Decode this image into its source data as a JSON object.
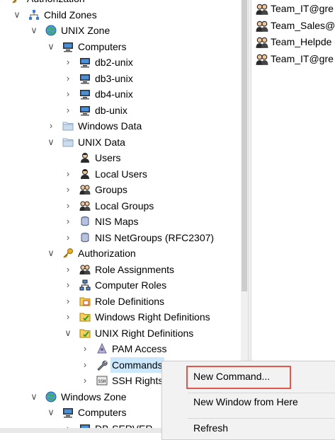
{
  "tree": [
    {
      "label": "Authorization",
      "icon": "key-icon",
      "chev": ">",
      "level": -1
    },
    {
      "label": "Child Zones",
      "icon": "org-chart-icon",
      "chev": "v",
      "level": 0
    },
    {
      "label": "UNIX Zone",
      "icon": "globe-icon",
      "chev": "v",
      "level": 1
    },
    {
      "label": "Computers",
      "icon": "computer-icon",
      "chev": "v",
      "level": 2
    },
    {
      "label": "db2-unix",
      "icon": "computer-icon",
      "chev": ">",
      "level": 3
    },
    {
      "label": "db3-unix",
      "icon": "computer-icon",
      "chev": ">",
      "level": 3
    },
    {
      "label": "db4-unix",
      "icon": "computer-icon",
      "chev": ">",
      "level": 3
    },
    {
      "label": "db-unix",
      "icon": "computer-icon",
      "chev": ">",
      "level": 3
    },
    {
      "label": "Windows Data",
      "icon": "folder-icon",
      "chev": ">",
      "level": 2
    },
    {
      "label": "UNIX Data",
      "icon": "folder-icon",
      "chev": "v",
      "level": 2
    },
    {
      "label": "Users",
      "icon": "user-icon",
      "chev": "",
      "level": 3
    },
    {
      "label": "Local Users",
      "icon": "user-icon",
      "chev": ">",
      "level": 3
    },
    {
      "label": "Groups",
      "icon": "group-icon",
      "chev": ">",
      "level": 3
    },
    {
      "label": "Local Groups",
      "icon": "group-icon",
      "chev": ">",
      "level": 3
    },
    {
      "label": "NIS Maps",
      "icon": "database-icon",
      "chev": ">",
      "level": 3
    },
    {
      "label": "NIS NetGroups (RFC2307)",
      "icon": "database-icon",
      "chev": ">",
      "level": 3
    },
    {
      "label": "Authorization",
      "icon": "key-icon",
      "chev": "v",
      "level": 2
    },
    {
      "label": "Role Assignments",
      "icon": "group-icon",
      "chev": ">",
      "level": 3
    },
    {
      "label": "Computer Roles",
      "icon": "network-icon",
      "chev": ">",
      "level": 3
    },
    {
      "label": "Role Definitions",
      "icon": "role-folder-icon",
      "chev": ">",
      "level": 3
    },
    {
      "label": "Windows Right Definitions",
      "icon": "rights-folder-icon",
      "chev": ">",
      "level": 3
    },
    {
      "label": "UNIX Right Definitions",
      "icon": "rights-folder-icon",
      "chev": "v",
      "level": 3
    },
    {
      "label": "PAM Access",
      "icon": "pam-icon",
      "chev": ">",
      "level": 4
    },
    {
      "label": "Commands",
      "icon": "wrench-icon",
      "chev": ">",
      "level": 4,
      "selected": true
    },
    {
      "label": "SSH Rights",
      "icon": "ssh-icon",
      "chev": ">",
      "level": 4
    },
    {
      "label": "Windows Zone",
      "icon": "globe-icon",
      "chev": "v",
      "level": 1
    },
    {
      "label": "Computers",
      "icon": "computer-icon",
      "chev": "v",
      "level": 2
    },
    {
      "label": "DB-SERVER",
      "icon": "computer-icon",
      "chev": ">",
      "level": 3
    }
  ],
  "list_items": [
    {
      "label": "Team_IT@gre",
      "icon": "group-icon"
    },
    {
      "label": "Team_Sales@",
      "icon": "group-icon"
    },
    {
      "label": "Team_Helpde",
      "icon": "group-icon"
    },
    {
      "label": "Team_IT@gre",
      "icon": "group-icon"
    }
  ],
  "context_menu": {
    "new_command": "New Command...",
    "new_window": "New Window from Here",
    "refresh": "Refresh"
  },
  "colors": {
    "selection": "#cce8ff",
    "highlight_border": "#e2574c"
  }
}
